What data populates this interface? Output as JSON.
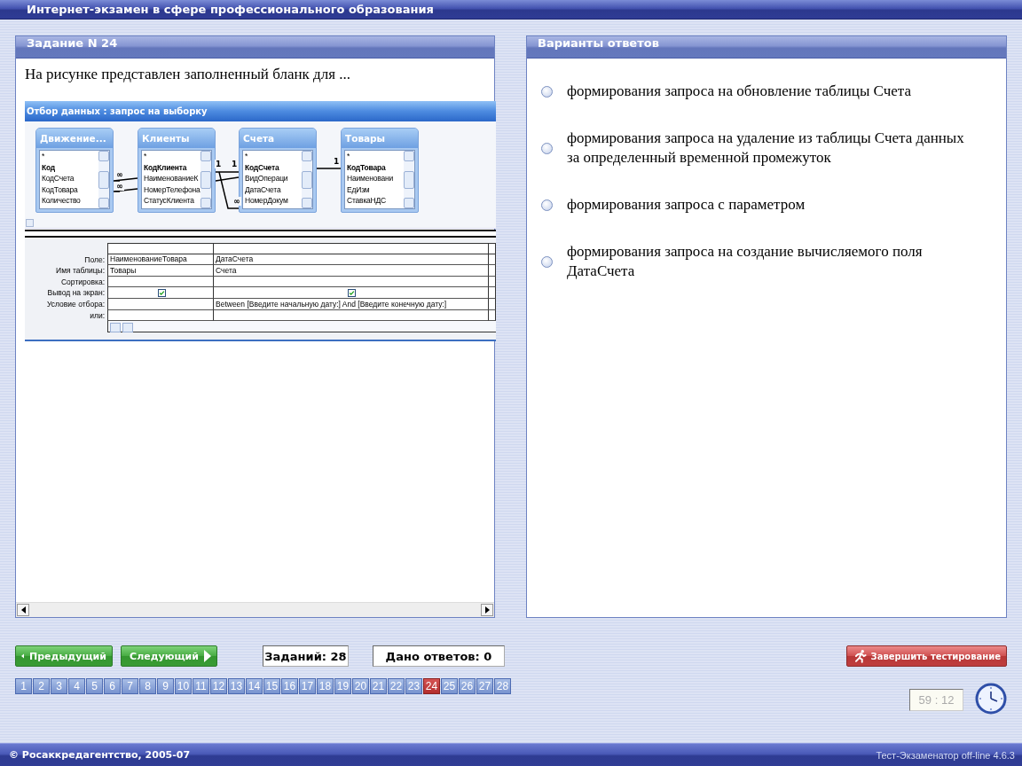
{
  "window": {
    "title": "Интернет-экзамен в сфере профессионального образования"
  },
  "task": {
    "header": "Задание N 24",
    "question": "На рисунке представлен заполненный бланк для ...",
    "figure": {
      "title": "Отбор данных : запрос на выборку",
      "tables": [
        {
          "name": "Движение...",
          "fields": [
            {
              "name": "*",
              "key": false
            },
            {
              "name": "Код",
              "key": true
            },
            {
              "name": "КодСчета",
              "key": false
            },
            {
              "name": "КодТовара",
              "key": false
            },
            {
              "name": "Количество",
              "key": false
            }
          ]
        },
        {
          "name": "Клиенты",
          "fields": [
            {
              "name": "*",
              "key": false
            },
            {
              "name": "КодКлиента",
              "key": true
            },
            {
              "name": "НаименованиеК",
              "key": false
            },
            {
              "name": "НомерТелефона",
              "key": false
            },
            {
              "name": "СтатусКлиента",
              "key": false
            }
          ]
        },
        {
          "name": "Счета",
          "fields": [
            {
              "name": "*",
              "key": false
            },
            {
              "name": "КодСчета",
              "key": true
            },
            {
              "name": "ВидОпераци",
              "key": false
            },
            {
              "name": "ДатаСчета",
              "key": false
            },
            {
              "name": "НомерДокум",
              "key": false
            }
          ]
        },
        {
          "name": "Товары",
          "fields": [
            {
              "name": "*",
              "key": false
            },
            {
              "name": "КодТовара",
              "key": true
            },
            {
              "name": "Наименовани",
              "key": false
            },
            {
              "name": "ЕдИзм",
              "key": false
            },
            {
              "name": "СтавкаНДС",
              "key": false
            }
          ]
        }
      ],
      "relation_marks": [
        "∞",
        "∞",
        "1",
        "1",
        "∞",
        "1"
      ],
      "grid": {
        "row_labels": [
          "Поле:",
          "Имя таблицы:",
          "Сортировка:",
          "Вывод на экран:",
          "Условие отбора:",
          "или:"
        ],
        "columns": [
          {
            "field": "НаименованиеТовара",
            "table": "Товары",
            "show": true
          },
          {
            "field": "ДатаСчета",
            "table": "Счета",
            "show": true,
            "criteria": "Between [Введите начальную дату:] And [Введите конечную дату:]"
          }
        ]
      }
    }
  },
  "answers": {
    "header": "Варианты ответов",
    "options": [
      {
        "text": "формирования запроса на обновление таблицы Счета",
        "selected": false
      },
      {
        "text": "формирования запроса на удаление из таблицы Счета данных за определенный временной промежуток",
        "selected": false
      },
      {
        "text": "формирования запроса с параметром",
        "selected": false
      },
      {
        "text": "формирования запроса на создание вычисляемого поля ДатаСчета",
        "selected": false
      }
    ]
  },
  "navigation": {
    "previous": "Предыдущий",
    "next": "Следующий",
    "tasks_total": "Заданий: 28",
    "answered": "Дано ответов: 0",
    "finish": "Завершить тестирование",
    "pages": [
      {
        "label": "1",
        "selected": false
      },
      {
        "label": "2",
        "selected": false
      },
      {
        "label": "3",
        "selected": false
      },
      {
        "label": "4",
        "selected": false
      },
      {
        "label": "5",
        "selected": false
      },
      {
        "label": "6",
        "selected": false
      },
      {
        "label": "7",
        "selected": false
      },
      {
        "label": "8",
        "selected": false
      },
      {
        "label": "9",
        "selected": false
      },
      {
        "label": "10",
        "selected": false
      },
      {
        "label": "11",
        "selected": false
      },
      {
        "label": "12",
        "selected": false
      },
      {
        "label": "13",
        "selected": false
      },
      {
        "label": "14",
        "selected": false
      },
      {
        "label": "15",
        "selected": false
      },
      {
        "label": "16",
        "selected": false
      },
      {
        "label": "17",
        "selected": false
      },
      {
        "label": "18",
        "selected": false
      },
      {
        "label": "19",
        "selected": false
      },
      {
        "label": "20",
        "selected": false
      },
      {
        "label": "21",
        "selected": false
      },
      {
        "label": "22",
        "selected": false
      },
      {
        "label": "23",
        "selected": false
      },
      {
        "label": "24",
        "selected": true
      },
      {
        "label": "25",
        "selected": false
      },
      {
        "label": "26",
        "selected": false
      },
      {
        "label": "27",
        "selected": false
      },
      {
        "label": "28",
        "selected": false
      }
    ],
    "timer": "59 : 12"
  },
  "footer": {
    "copyright": "© Росаккредагентство, 2005-07",
    "version": "Тест-Экзаменатор off-line 4.6.3"
  }
}
